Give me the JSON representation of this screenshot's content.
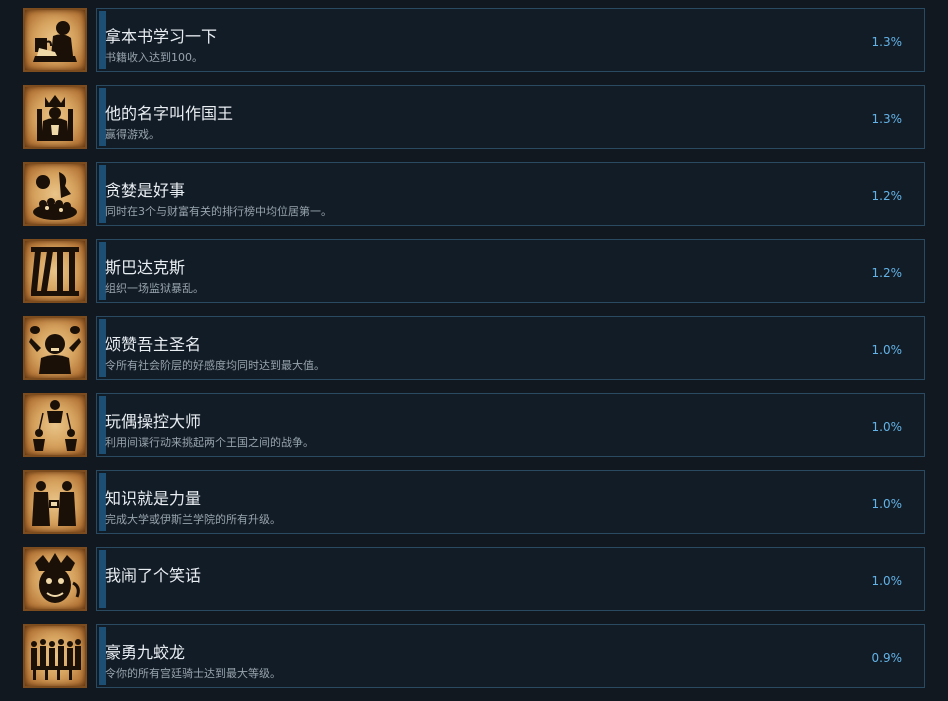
{
  "achievements": [
    {
      "title": "拿本书学习一下",
      "desc": "书籍收入达到100。",
      "percent": "1.3%",
      "icon": "scholar-reading-icon"
    },
    {
      "title": "他的名字叫作国王",
      "desc": "赢得游戏。",
      "percent": "1.3%",
      "icon": "king-on-throne-icon"
    },
    {
      "title": "贪婪是好事",
      "desc": "同时在3个与财富有关的排行榜中均位居第一。",
      "percent": "1.2%",
      "icon": "gold-pile-icon"
    },
    {
      "title": "斯巴达克斯",
      "desc": "组织一场监狱暴乱。",
      "percent": "1.2%",
      "icon": "prison-bars-icon"
    },
    {
      "title": "颂赞吾主圣名",
      "desc": "令所有社会阶层的好感度均同时达到最大值。",
      "percent": "1.0%",
      "icon": "cheering-crowd-icon"
    },
    {
      "title": "玩偶操控大师",
      "desc": "利用间谍行动来挑起两个王国之间的战争。",
      "percent": "1.0%",
      "icon": "puppet-master-icon"
    },
    {
      "title": "知识就是力量",
      "desc": "完成大学或伊斯兰学院的所有升级。",
      "percent": "1.0%",
      "icon": "scholars-debate-icon"
    },
    {
      "title": "我闹了个笑话",
      "desc": "",
      "percent": "1.0%",
      "icon": "jester-face-icon"
    },
    {
      "title": "豪勇九蛟龙",
      "desc": "令你的所有宫廷骑士达到最大等级。",
      "percent": "0.9%",
      "icon": "knights-army-icon"
    }
  ],
  "colors": {
    "background": "#111820",
    "row_border": "#2a4a62",
    "accent_bar": "#1d4e73",
    "percent_text": "#63b3e8",
    "title_text": "#e9eef3",
    "desc_text": "#97a3ae",
    "parchment": "#d7a460"
  }
}
